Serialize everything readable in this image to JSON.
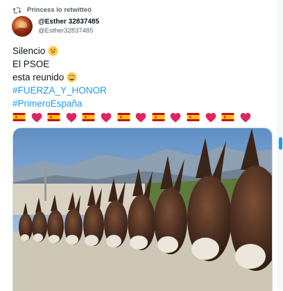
{
  "retweet": {
    "label": "Princess lo retwitteó"
  },
  "author": {
    "display_name": "@Esther 32837485",
    "handle": "@Esther32837485"
  },
  "tweet": {
    "lines": [
      "Silencio",
      "El PSOE",
      "esta reunido"
    ],
    "hashtags": [
      "#FUERZA_Y_HONOR",
      "#PrimeroEspaña"
    ],
    "emoji_sequence": [
      "spain-flag",
      "red-heart",
      "spain-flag",
      "red-heart",
      "spain-flag",
      "red-heart",
      "spain-flag",
      "red-heart",
      "spain-flag",
      "red-heart",
      "spain-flag",
      "red-heart",
      "spain-flag",
      "red-heart"
    ]
  },
  "media": {
    "subject": "row-of-donkeys-photo"
  },
  "colors": {
    "hashtag": "#1d9bf0",
    "secondary_text": "#536471",
    "heart": "#e0245e",
    "flag_red": "#c60b1e",
    "flag_yellow": "#ffc400"
  }
}
